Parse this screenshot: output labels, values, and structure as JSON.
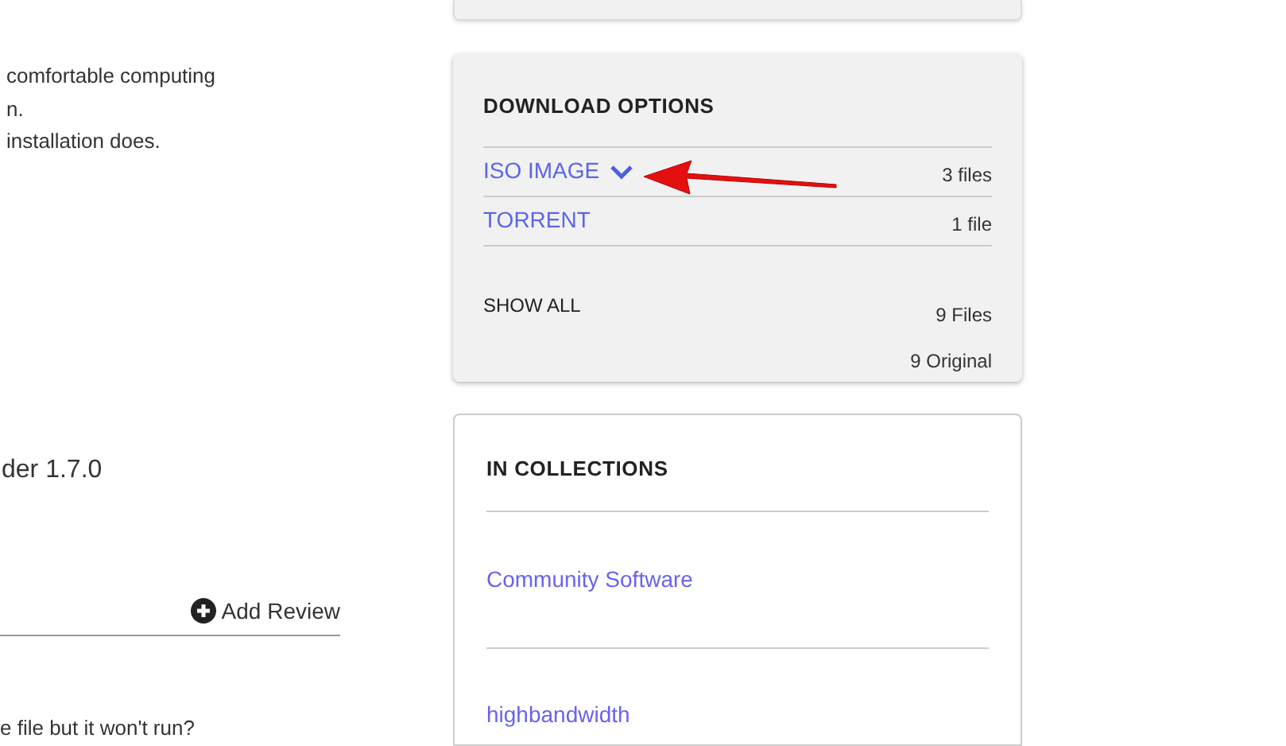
{
  "description": {
    "lines": [
      "comfortable computing",
      "n.",
      "installation does."
    ]
  },
  "version_title": "der 1.7.0",
  "reviews": {
    "add_button": "Add Review",
    "question": "e file but it won't run?"
  },
  "download_options": {
    "title": "DOWNLOAD OPTIONS",
    "items": [
      {
        "label": "ISO IMAGE",
        "count": "3 files",
        "expanded": false,
        "kind": "dropdown"
      },
      {
        "label": "TORRENT",
        "count": "1 file",
        "kind": "link"
      }
    ],
    "show_all": "SHOW ALL",
    "totals": [
      "9 Files",
      "9 Original"
    ]
  },
  "annotation": {
    "kind": "arrow"
  },
  "collections": {
    "title": "IN COLLECTIONS",
    "items": [
      "Community Software",
      "highbandwidth"
    ]
  }
}
